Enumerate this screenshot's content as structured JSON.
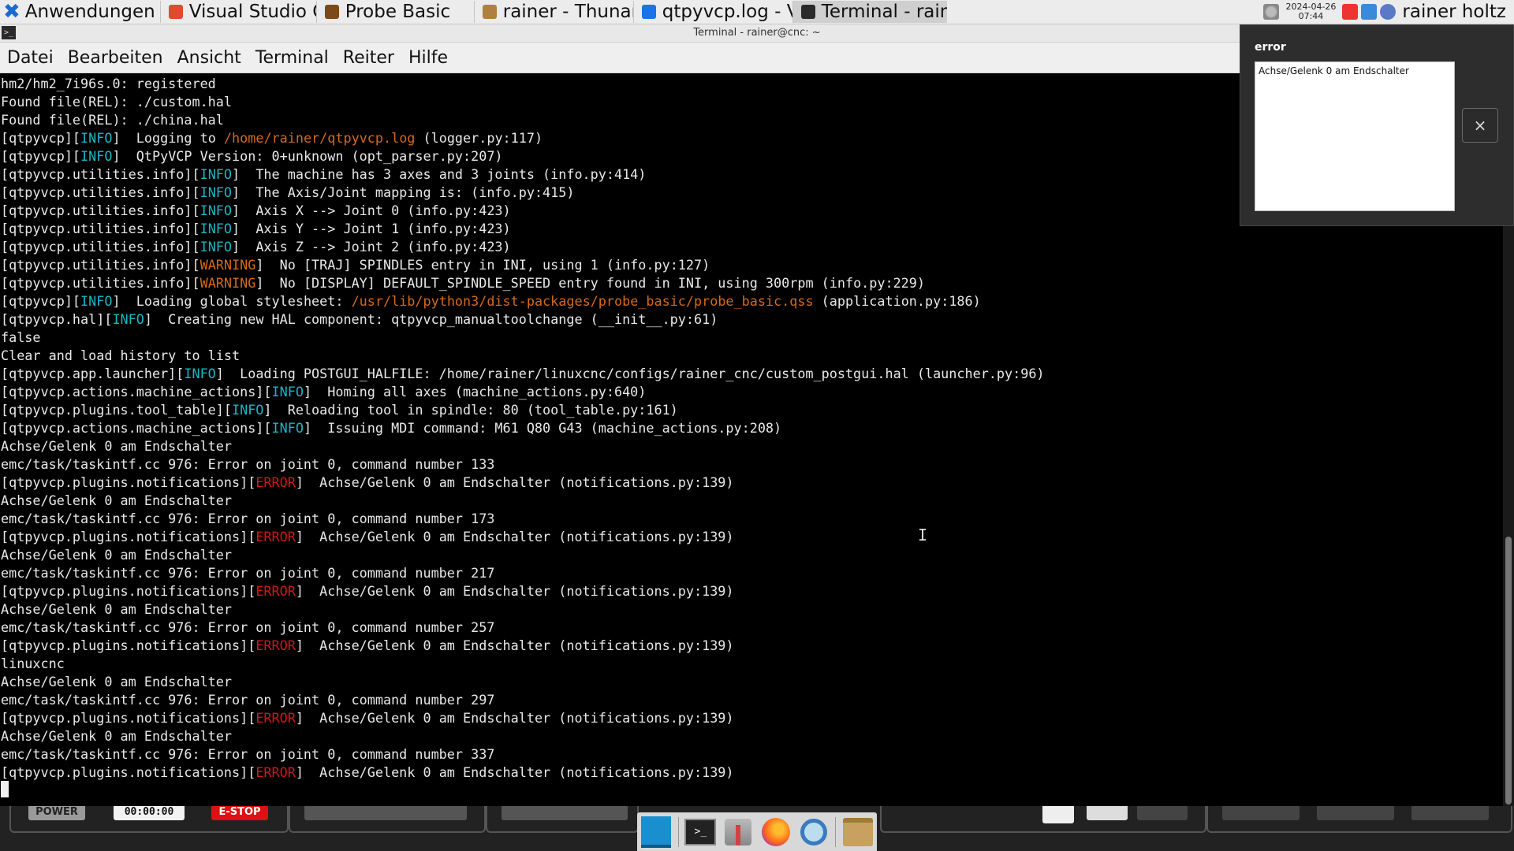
{
  "top_panel": {
    "apps_menu_label": "Anwendungen",
    "tasks": [
      {
        "label": "Visual Studio C...",
        "icon": "vscode-icon",
        "color": "#e04a2f"
      },
      {
        "label": "Probe Basic",
        "icon": "probe-basic-icon",
        "color": "#7a4a1a"
      },
      {
        "label": "rainer - Thunar",
        "icon": "folder-icon",
        "color": "#b08040"
      },
      {
        "label": "qtpyvcp.log - V...",
        "icon": "vscode-icon",
        "color": "#1a73e8"
      },
      {
        "label": "Terminal - rain...",
        "icon": "terminal-icon",
        "color": "#2a2a2a"
      }
    ],
    "clock_date": "2024-04-26",
    "clock_time": "07:44",
    "user_name": "rainer holtz"
  },
  "terminal_window": {
    "title": "Terminal - rainer@cnc: ~",
    "menu": [
      "Datei",
      "Bearbeiten",
      "Ansicht",
      "Terminal",
      "Reiter",
      "Hilfe"
    ]
  },
  "terminal_lines": [
    [
      {
        "t": "hm2/hm2_7i96s.0: registered"
      }
    ],
    [
      {
        "t": "Found file(REL): ./custom.hal"
      }
    ],
    [
      {
        "t": "Found file(REL): ./china.hal"
      }
    ],
    [
      {
        "t": "[qtpyvcp]["
      },
      {
        "t": "INFO",
        "c": "cyan"
      },
      {
        "t": "]  Logging to "
      },
      {
        "t": "/home/rainer/qtpyvcp.log",
        "c": "orange"
      },
      {
        "t": " (logger.py:117)"
      }
    ],
    [
      {
        "t": "[qtpyvcp]["
      },
      {
        "t": "INFO",
        "c": "cyan"
      },
      {
        "t": "]  QtPyVCP Version: 0+unknown (opt_parser.py:207)"
      }
    ],
    [
      {
        "t": "[qtpyvcp.utilities.info]["
      },
      {
        "t": "INFO",
        "c": "cyan"
      },
      {
        "t": "]  The machine has 3 axes and 3 joints (info.py:414)"
      }
    ],
    [
      {
        "t": "[qtpyvcp.utilities.info]["
      },
      {
        "t": "INFO",
        "c": "cyan"
      },
      {
        "t": "]  The Axis/Joint mapping is: (info.py:415)"
      }
    ],
    [
      {
        "t": "[qtpyvcp.utilities.info]["
      },
      {
        "t": "INFO",
        "c": "cyan"
      },
      {
        "t": "]  Axis X --> Joint 0 (info.py:423)"
      }
    ],
    [
      {
        "t": "[qtpyvcp.utilities.info]["
      },
      {
        "t": "INFO",
        "c": "cyan"
      },
      {
        "t": "]  Axis Y --> Joint 1 (info.py:423)"
      }
    ],
    [
      {
        "t": "[qtpyvcp.utilities.info]["
      },
      {
        "t": "INFO",
        "c": "cyan"
      },
      {
        "t": "]  Axis Z --> Joint 2 (info.py:423)"
      }
    ],
    [
      {
        "t": "[qtpyvcp.utilities.info]["
      },
      {
        "t": "WARNING",
        "c": "orange"
      },
      {
        "t": "]  No [TRAJ] SPINDLES entry in INI, using 1 (info.py:127)"
      }
    ],
    [
      {
        "t": "[qtpyvcp.utilities.info]["
      },
      {
        "t": "WARNING",
        "c": "orange"
      },
      {
        "t": "]  No [DISPLAY] DEFAULT_SPINDLE_SPEED entry found in INI, using 300rpm (info.py:229)"
      }
    ],
    [
      {
        "t": "[qtpyvcp]["
      },
      {
        "t": "INFO",
        "c": "cyan"
      },
      {
        "t": "]  Loading global stylesheet: "
      },
      {
        "t": "/usr/lib/python3/dist-packages/probe_basic/probe_basic.qss",
        "c": "orange"
      },
      {
        "t": " (application.py:186)"
      }
    ],
    [
      {
        "t": "[qtpyvcp.hal]["
      },
      {
        "t": "INFO",
        "c": "cyan"
      },
      {
        "t": "]  Creating new HAL component: qtpyvcp_manualtoolchange (__init__.py:61)"
      }
    ],
    [
      {
        "t": "false"
      }
    ],
    [
      {
        "t": "Clear and load history to list"
      }
    ],
    [
      {
        "t": "[qtpyvcp.app.launcher]["
      },
      {
        "t": "INFO",
        "c": "cyan"
      },
      {
        "t": "]  Loading POSTGUI_HALFILE: /home/rainer/linuxcnc/configs/rainer_cnc/custom_postgui.hal (launcher.py:96)"
      }
    ],
    [
      {
        "t": "[qtpyvcp.actions.machine_actions]["
      },
      {
        "t": "INFO",
        "c": "cyan"
      },
      {
        "t": "]  Homing all axes (machine_actions.py:640)"
      }
    ],
    [
      {
        "t": "[qtpyvcp.plugins.tool_table]["
      },
      {
        "t": "INFO",
        "c": "cyan"
      },
      {
        "t": "]  Reloading tool in spindle: 80 (tool_table.py:161)"
      }
    ],
    [
      {
        "t": "[qtpyvcp.actions.machine_actions]["
      },
      {
        "t": "INFO",
        "c": "cyan"
      },
      {
        "t": "]  Issuing MDI command: M61 Q80 G43 (machine_actions.py:208)"
      }
    ],
    [
      {
        "t": "Achse/Gelenk 0 am Endschalter"
      }
    ],
    [
      {
        "t": "emc/task/taskintf.cc 976: Error on joint 0, command number 133"
      }
    ],
    [
      {
        "t": "[qtpyvcp.plugins.notifications]["
      },
      {
        "t": "ERROR",
        "c": "red"
      },
      {
        "t": "]  Achse/Gelenk 0 am Endschalter (notifications.py:139)"
      }
    ],
    [
      {
        "t": "Achse/Gelenk 0 am Endschalter"
      }
    ],
    [
      {
        "t": "emc/task/taskintf.cc 976: Error on joint 0, command number 173"
      }
    ],
    [
      {
        "t": "[qtpyvcp.plugins.notifications]["
      },
      {
        "t": "ERROR",
        "c": "red"
      },
      {
        "t": "]  Achse/Gelenk 0 am Endschalter (notifications.py:139)"
      }
    ],
    [
      {
        "t": "Achse/Gelenk 0 am Endschalter"
      }
    ],
    [
      {
        "t": "emc/task/taskintf.cc 976: Error on joint 0, command number 217"
      }
    ],
    [
      {
        "t": "[qtpyvcp.plugins.notifications]["
      },
      {
        "t": "ERROR",
        "c": "red"
      },
      {
        "t": "]  Achse/Gelenk 0 am Endschalter (notifications.py:139)"
      }
    ],
    [
      {
        "t": "Achse/Gelenk 0 am Endschalter"
      }
    ],
    [
      {
        "t": "emc/task/taskintf.cc 976: Error on joint 0, command number 257"
      }
    ],
    [
      {
        "t": "[qtpyvcp.plugins.notifications]["
      },
      {
        "t": "ERROR",
        "c": "red"
      },
      {
        "t": "]  Achse/Gelenk 0 am Endschalter (notifications.py:139)"
      }
    ],
    [
      {
        "t": "linuxcnc"
      }
    ],
    [
      {
        "t": "Achse/Gelenk 0 am Endschalter"
      }
    ],
    [
      {
        "t": "emc/task/taskintf.cc 976: Error on joint 0, command number 297"
      }
    ],
    [
      {
        "t": "[qtpyvcp.plugins.notifications]["
      },
      {
        "t": "ERROR",
        "c": "red"
      },
      {
        "t": "]  Achse/Gelenk 0 am Endschalter (notifications.py:139)"
      }
    ],
    [
      {
        "t": "Achse/Gelenk 0 am Endschalter"
      }
    ],
    [
      {
        "t": "emc/task/taskintf.cc 976: Error on joint 0, command number 337"
      }
    ],
    [
      {
        "t": "[qtpyvcp.plugins.notifications]["
      },
      {
        "t": "ERROR",
        "c": "red"
      },
      {
        "t": "]  Achse/Gelenk 0 am Endschalter (notifications.py:139)"
      }
    ]
  ],
  "background_app": {
    "power_label": "POWER",
    "timer_value": "00:00:00",
    "estop_label": "E-STOP"
  },
  "dock": {
    "items": [
      "show-desktop-icon",
      "terminal-icon",
      "settings-tools-icon",
      "firefox-icon",
      "search-magnifier-icon",
      "file-manager-icon"
    ]
  },
  "error_popup": {
    "title": "error",
    "message": "Achse/Gelenk 0 am Endschalter",
    "close_symbol": "×"
  },
  "colors": {
    "info": "#1ab7c4",
    "warning": "#d46a1a",
    "error": "#d01818"
  }
}
